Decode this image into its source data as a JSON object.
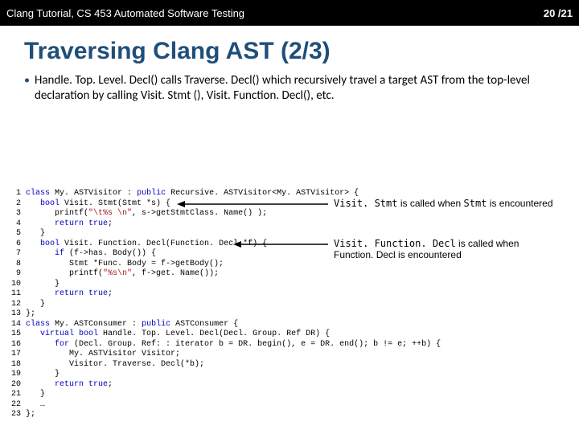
{
  "header": {
    "left": "Clang Tutorial, CS 453 Automated Software Testing",
    "right": "20 /21"
  },
  "title": "Traversing Clang AST (2/3)",
  "bullet": "Handle. Top. Level. Decl() calls Traverse. Decl() which recursively travel a target AST from the top-level declaration by calling Visit. Stmt (), Visit. Function. Decl(), etc.",
  "annotations": {
    "a1_pre": "Visit. Stmt",
    "a1_post": " is called when ",
    "a1_code": "Stmt",
    "a1_tail": " is encountered",
    "a2_pre": "Visit. Function. Decl",
    "a2_post": " is called when",
    "a2_line2": "Function. Decl is encountered"
  },
  "code": {
    "l01a": "class",
    "l01b": " My. ASTVisitor : ",
    "l01c": "public",
    "l01d": " Recursive. ASTVisitor<My. ASTVisitor> {",
    "l02a": "   bool",
    "l02b": " Visit. Stmt(Stmt *s) {",
    "l03a": "      printf(",
    "l03b": "\"\\t%s \\n\"",
    "l03c": ", s->getStmtClass. Name() );",
    "l04a": "      return",
    "l04b": " true",
    "l04c": ";",
    "l05": "   }",
    "l06a": "   bool",
    "l06b": " Visit. Function. Decl(Function. Decl *f) {",
    "l07a": "      if",
    "l07b": " (f->has. Body()) {",
    "l08": "         Stmt *Func. Body = f->getBody();",
    "l09a": "         printf(",
    "l09b": "\"%s\\n\"",
    "l09c": ", f->get. Name());",
    "l10": "      }",
    "l11a": "      return",
    "l11b": " true",
    "l11c": ";",
    "l12": "   }",
    "l13": "};",
    "l14a": "class",
    "l14b": " My. ASTConsumer : ",
    "l14c": "public",
    "l14d": " ASTConsumer {",
    "l15a": "   virtual",
    "l15b": " bool",
    "l15c": " Handle. Top. Level. Decl(Decl. Group. Ref DR) {",
    "l16a": "      for",
    "l16b": " (Decl. Group. Ref: : iterator b = DR. begin(), e = DR. end(); b != e; ++b) {",
    "l17": "         My. ASTVisitor Visitor;",
    "l18": "         Visitor. Traverse. Decl(*b);",
    "l19": "      }",
    "l20a": "      return",
    "l20b": " true",
    "l20c": ";",
    "l21": "   }",
    "l22": "   …",
    "l23": "};"
  }
}
